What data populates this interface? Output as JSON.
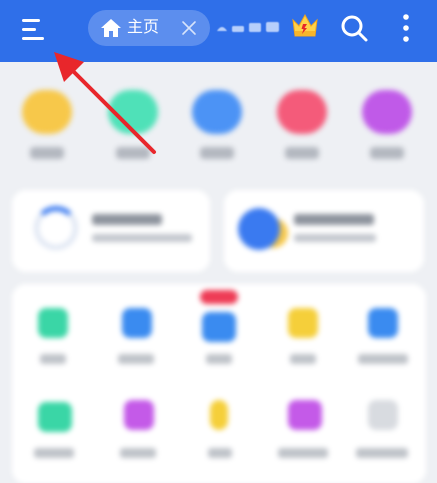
{
  "header": {
    "tab_label": "主页",
    "colors": {
      "bar": "#2f6fe9",
      "accent": "#ff3b3b"
    },
    "icons": [
      "menu-icon",
      "home-icon",
      "close-icon",
      "crown-icon",
      "search-icon",
      "more-vertical-icon"
    ]
  },
  "content_state": "blurred",
  "annotation": {
    "color": "#e8262b",
    "points_to": "menu-button"
  }
}
